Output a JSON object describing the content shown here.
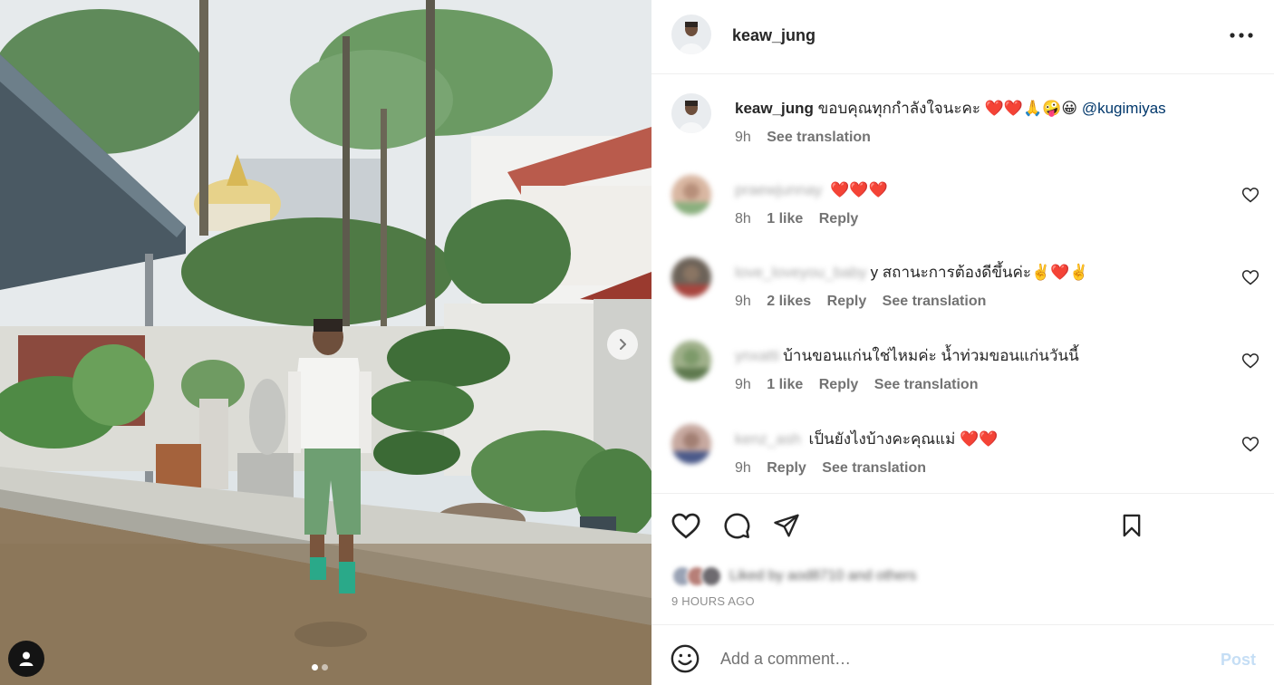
{
  "header": {
    "username": "keaw_jung"
  },
  "caption": {
    "username": "keaw_jung",
    "text": "ขอบคุณทุกกำลังใจนะคะ ❤️❤️🙏🤪😀",
    "mention": "@kugimiyas",
    "time": "9h",
    "see_translation": "See translation"
  },
  "comments": [
    {
      "username": "praewjunnay",
      "text": "❤️❤️❤️",
      "time": "8h",
      "likes": "1 like",
      "reply": "Reply",
      "see_translation": ""
    },
    {
      "username": "love_loveyou_baby",
      "text": "y สถานะการต้องดีขึ้นค่ะ✌️❤️✌️",
      "time": "9h",
      "likes": "2 likes",
      "reply": "Reply",
      "see_translation": "See translation"
    },
    {
      "username": "ynxatti",
      "text": "บ้านขอนแก่นใช่ไหมค่ะ น้ำท่วมขอนแก่นวันนี้",
      "time": "9h",
      "likes": "1 like",
      "reply": "Reply",
      "see_translation": "See translation"
    },
    {
      "username": "kenz_ash",
      "text": "เป็นยังไงบ้างคะคุณแม่ ❤️❤️",
      "time": "9h",
      "likes": "",
      "reply": "Reply",
      "see_translation": "See translation"
    }
  ],
  "icons": {
    "more": "more-horizontal-icon",
    "like": "heart-icon",
    "comment": "comment-bubble-icon",
    "share": "paper-plane-icon",
    "save": "bookmark-icon",
    "emoji": "smiley-icon",
    "tag": "user-tag-icon",
    "next": "chevron-right-icon"
  },
  "liked_by": {
    "text": "Liked by aod8710 and others"
  },
  "timestamp": "9 HOURS AGO",
  "comment_box": {
    "placeholder": "Add a comment…",
    "post_label": "Post"
  },
  "carousel": {
    "current": 1,
    "total": 2
  },
  "colors": {
    "text": "#262626",
    "secondary": "#737373",
    "link": "#00376b",
    "post_disabled": "#c5def5",
    "heart": "#ed4956"
  }
}
